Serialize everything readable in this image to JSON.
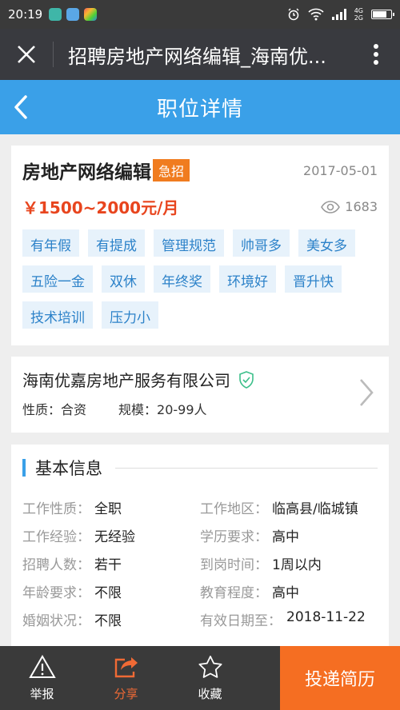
{
  "status_bar": {
    "time": "20:19",
    "net_top": "4G",
    "net_bottom": "2G"
  },
  "app_bar": {
    "title": "招聘房地产网络编辑_海南优..."
  },
  "page_header": {
    "title": "职位详情"
  },
  "job": {
    "title": "房地产网络编辑",
    "urgent_badge": "急招",
    "date": "2017-05-01",
    "salary": "￥1500~2000元/月",
    "views": "1683",
    "tags": [
      "有年假",
      "有提成",
      "管理规范",
      "帅哥多",
      "美女多",
      "五险一金",
      "双休",
      "年终奖",
      "环境好",
      "晋升快",
      "技术培训",
      "压力小"
    ]
  },
  "company": {
    "name": "海南优嘉房地产服务有限公司",
    "nature": "性质：合资",
    "scale": "规模：20-99人"
  },
  "basic_info": {
    "title": "基本信息",
    "items": [
      {
        "label": "工作性质：",
        "value": "全职"
      },
      {
        "label": "工作地区：",
        "value": "临高县/临城镇"
      },
      {
        "label": "工作经验：",
        "value": "无经验"
      },
      {
        "label": "学历要求：",
        "value": "高中"
      },
      {
        "label": "招聘人数：",
        "value": "若干"
      },
      {
        "label": "到岗时间：",
        "value": "1周以内"
      },
      {
        "label": "年龄要求：",
        "value": "不限"
      },
      {
        "label": "教育程度：",
        "value": "高中"
      },
      {
        "label": "婚姻状况：",
        "value": "不限"
      },
      {
        "label": "有效日期至：",
        "value": "2018-11-22"
      }
    ]
  },
  "bottom_bar": {
    "report": "举报",
    "share": "分享",
    "favorite": "收藏",
    "apply": "投递简历"
  },
  "colors": {
    "accent_blue": "#3aa0e8",
    "salary_red": "#e8451e",
    "urgent_orange": "#f07c1f",
    "apply_orange": "#f56e22"
  }
}
